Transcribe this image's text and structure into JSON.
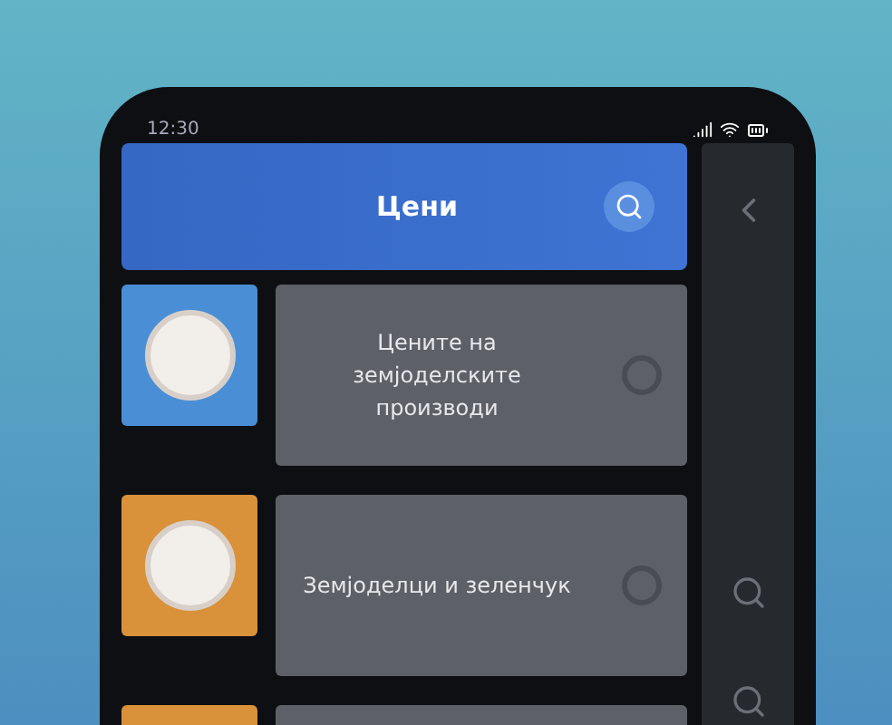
{
  "status_bar": {
    "time": "12:30"
  },
  "header": {
    "title": "Цени"
  },
  "items": [
    {
      "color": "#4a8fd6",
      "text": "Цените на земјоделските производи"
    },
    {
      "color": "#d9913a",
      "text": "Земјоделци и зеленчук"
    },
    {
      "color": "#d9913a"
    }
  ]
}
